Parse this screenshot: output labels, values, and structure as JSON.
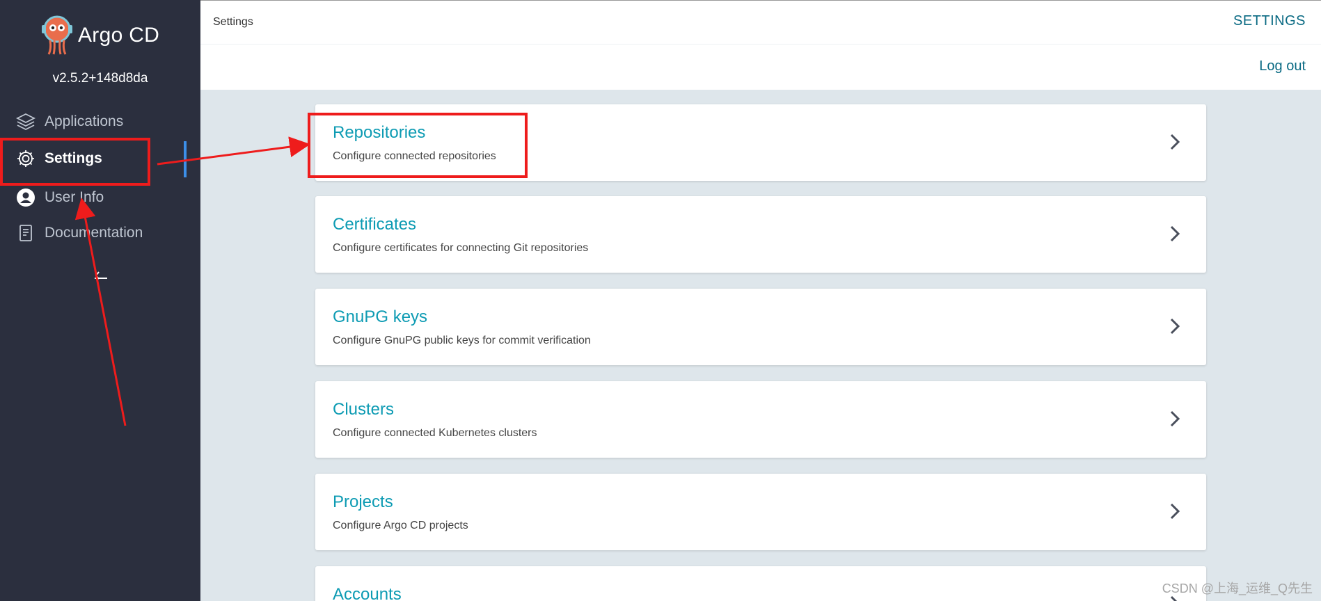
{
  "sidebar": {
    "brand_name": "Argo CD",
    "version": "v2.5.2+148d8da",
    "items": [
      {
        "label": "Applications",
        "icon": "layers-icon"
      },
      {
        "label": "Settings",
        "icon": "gear-icon",
        "active": true
      },
      {
        "label": "User Info",
        "icon": "user-icon"
      },
      {
        "label": "Documentation",
        "icon": "document-icon"
      }
    ]
  },
  "header": {
    "breadcrumb": "Settings",
    "title": "SETTINGS",
    "logout_label": "Log out"
  },
  "cards": [
    {
      "title": "Repositories",
      "description": "Configure connected repositories"
    },
    {
      "title": "Certificates",
      "description": "Configure certificates for connecting Git repositories"
    },
    {
      "title": "GnuPG keys",
      "description": "Configure GnuPG public keys for commit verification"
    },
    {
      "title": "Clusters",
      "description": "Configure connected Kubernetes clusters"
    },
    {
      "title": "Projects",
      "description": "Configure Argo CD projects"
    },
    {
      "title": "Accounts",
      "description": ""
    }
  ],
  "colors": {
    "sidebar_bg": "#2b2f3e",
    "accent_teal": "#0d9bb3",
    "header_link": "#0a6a83",
    "annotation_red": "#ee1c1c",
    "active_indicator": "#3c8fe8"
  },
  "watermark": "CSDN @上海_运维_Q先生"
}
